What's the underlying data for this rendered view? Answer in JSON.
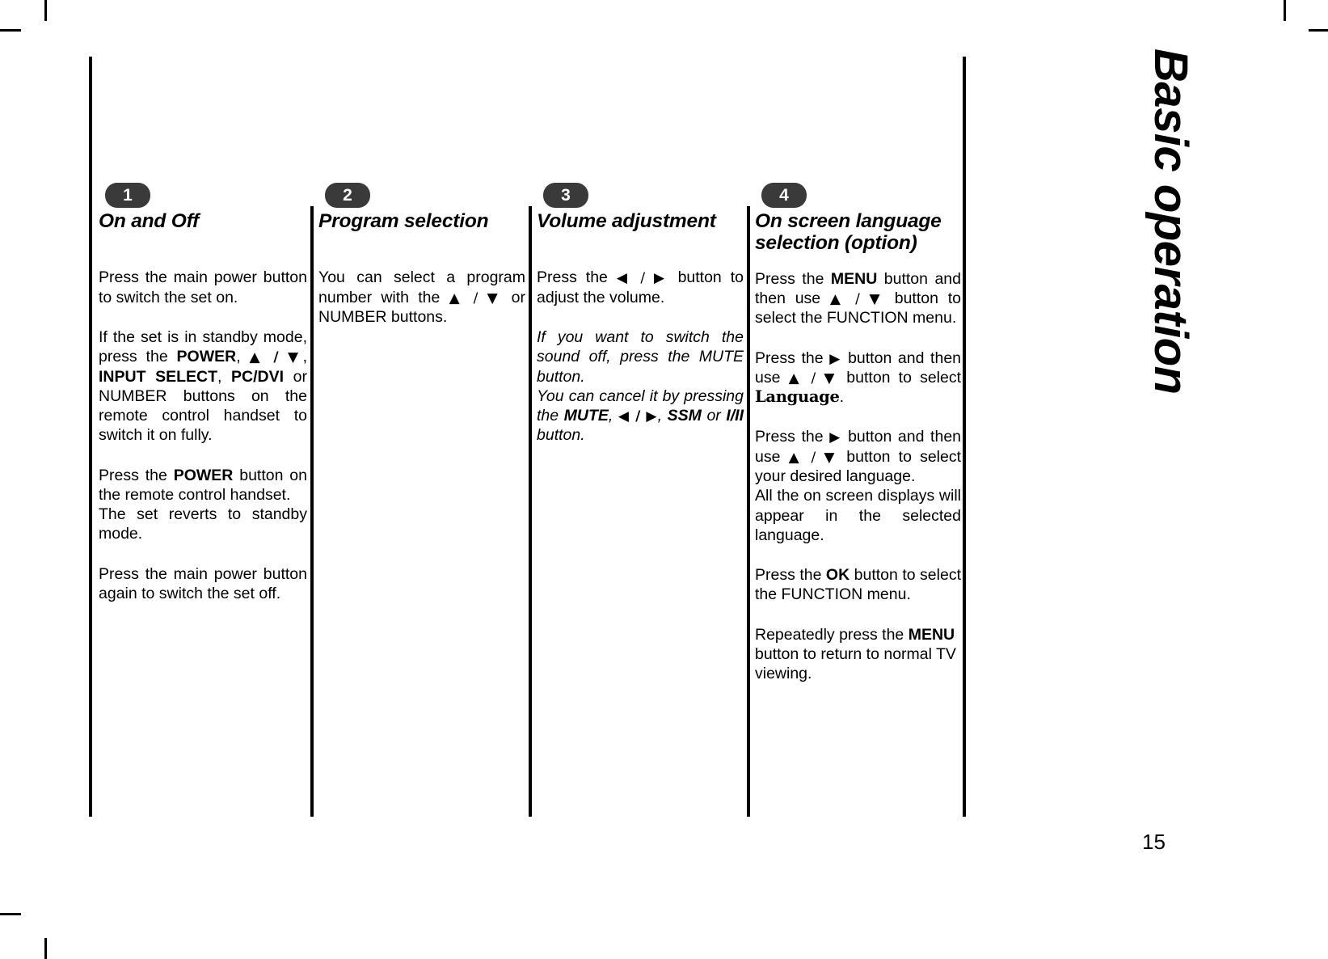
{
  "page": {
    "running_head": "Basic operation",
    "page_number": "15"
  },
  "columns": [
    {
      "badge": "1",
      "title": "On and Off",
      "paragraphs": [
        "Press the main power button to switch the set on.",
        "If the set is in standby mode, press the POWER, ▲ / ▼, INPUT SELECT, PC/DVI or NUMBER buttons on the remote control handset to switch it on fully.",
        "Press the POWER button on the remote control handset.\nThe set reverts to standby mode.",
        "Press the main power button again to switch the set off."
      ],
      "bold_terms": [
        "POWER",
        "INPUT SELECT",
        "PC/DVI"
      ]
    },
    {
      "badge": "2",
      "title": "Program selection",
      "paragraphs": [
        "You can select a program number with the ▲ / ▼ or NUMBER buttons."
      ],
      "bold_terms": []
    },
    {
      "badge": "3",
      "title": "Volume adjustment",
      "paragraphs": [
        "Press the ◀ / ▶ button to adjust the volume.",
        "If you want to switch the sound off, press the MUTE button.\nYou can cancel it by pressing the MUTE, ◀ / ▶, SSM or I/II button."
      ],
      "bold_terms": [
        "MUTE",
        "SSM",
        "I/II"
      ]
    },
    {
      "badge": "4",
      "title": "On screen language selection (option)",
      "paragraphs": [
        "Press the MENU button and then use ▲ / ▼ button to select the FUNCTION menu.",
        "Press the ▶ button and then use ▲ / ▼ button to select Language.",
        "Press the ▶ button and then use ▲ / ▼ button to select your desired language.\nAll the on screen displays will appear in the selected language.",
        "Press the OK button to select the FUNCTION menu.",
        "Repeatedly press the MENU button to return to normal TV viewing."
      ],
      "bold_terms": [
        "MENU",
        "Language",
        "OK"
      ]
    }
  ],
  "col1": {
    "badge": "1",
    "title": "On and Off",
    "p1": "Press the main power button to switch the set on.",
    "p2_a": "If the set is in standby mode, press the ",
    "p2_power": "POWER",
    "p2_b": ", ",
    "p2_updown": "▲ / ▼",
    "p2_c": ", ",
    "p2_input": "INPUT SELECT",
    "p2_d": ", ",
    "p2_pcdvi": "PC/DVI",
    "p2_e": " or NUMBER buttons on the remote control handset to switch it on fully.",
    "p3_a": "Press the ",
    "p3_power": "POWER",
    "p3_b": " button on the remote control handset.",
    "p3_c": "The set reverts to standby mode.",
    "p4": "Press the main power button again to switch the set off."
  },
  "col2": {
    "badge": "2",
    "title": "Program selection",
    "p1_a": "You can select a program number with the ",
    "p1_updown": "▲ / ▼",
    "p1_b": " or NUMBER buttons."
  },
  "col3": {
    "badge": "3",
    "title": "Volume adjustment",
    "p1_a": "Press the ",
    "p1_lr": "◀ / ▶",
    "p1_b": " button to adjust the volume.",
    "p2_a": "If you want to switch the sound off, press the MUTE button.",
    "p2_b": "You can cancel it by pressing the ",
    "p2_mute": "MUTE",
    "p2_c": ", ",
    "p2_lr": "◀ / ▶",
    "p2_d": ", ",
    "p2_ssm": "SSM",
    "p2_e": " or ",
    "p2_iii": "I/II",
    "p2_f": " button."
  },
  "col4": {
    "badge": "4",
    "title": "On screen language selection (option)",
    "p1_a": "Press the ",
    "p1_menu": "MENU",
    "p1_b": " button and then use ",
    "p1_updown": "▲ / ▼",
    "p1_c": " button to select the FUNCTION menu.",
    "p2_a": "Press the ",
    "p2_right": "▶",
    "p2_b": " button and then use ",
    "p2_updown": "▲ / ▼",
    "p2_c": " button to select ",
    "p2_language": "Language",
    "p2_d": ".",
    "p3_a": "Press the ",
    "p3_right": "▶",
    "p3_b": " button and then use ",
    "p3_updown": "▲ / ▼",
    "p3_c": " button to select your desired language.",
    "p3_d": "All the on screen displays will appear in the selected language.",
    "p4_a": "Press the ",
    "p4_ok": "OK",
    "p4_b": " button to select the FUNCTION menu.",
    "p5_a": "Repeatedly press the ",
    "p5_menu": "MENU",
    "p5_b": " button to return to normal TV viewing."
  }
}
